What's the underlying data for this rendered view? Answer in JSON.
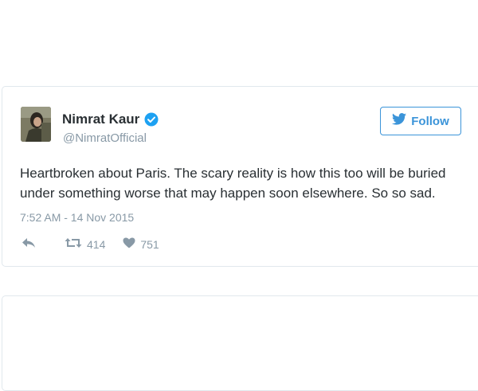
{
  "tweet": {
    "display_name": "Nimrat Kaur",
    "handle": "@NimratOfficial",
    "verified": true,
    "follow_label": "Follow",
    "text": "Heartbroken about Paris. The scary reality is how this too will be buried under something worse that may happen soon elsewhere. So so sad.",
    "timestamp": "7:52 AM - 14 Nov 2015",
    "retweet_count": "414",
    "like_count": "751"
  },
  "icons": {
    "avatar": "avatar",
    "verified": "verified-badge-icon",
    "follow": "twitter-bird-icon",
    "reply": "reply-icon",
    "retweet": "retweet-icon",
    "like": "heart-icon"
  },
  "colors": {
    "brand_blue": "#3b94d9",
    "verified_blue": "#1da1f2",
    "muted": "#8899a6",
    "text": "#292f33",
    "border": "#e1e8ed"
  }
}
